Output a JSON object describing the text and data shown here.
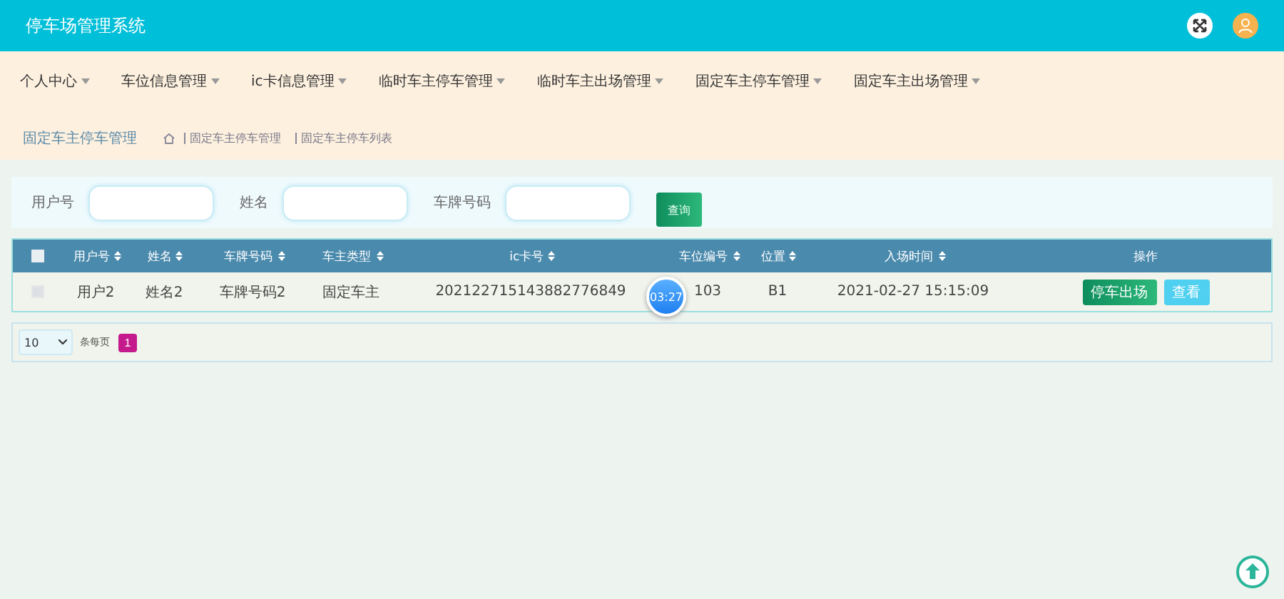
{
  "header": {
    "title": "停车场管理系统"
  },
  "menu": [
    {
      "label": "个人中心"
    },
    {
      "label": "车位信息管理"
    },
    {
      "label": "ic卡信息管理"
    },
    {
      "label": "临时车主停车管理"
    },
    {
      "label": "临时车主出场管理"
    },
    {
      "label": "固定车主停车管理"
    },
    {
      "label": "固定车主出场管理"
    }
  ],
  "breadcrumb": {
    "title": "固定车主停车管理",
    "path": [
      "固定车主停车管理",
      "固定车主停车列表"
    ]
  },
  "search": {
    "fields": [
      {
        "label": "用户号"
      },
      {
        "label": "姓名"
      },
      {
        "label": "车牌号码"
      }
    ],
    "button": "查询"
  },
  "table": {
    "select_all": false,
    "columns": [
      "用户号",
      "姓名",
      "车牌号码",
      "车主类型",
      "ic卡号",
      "车位编号",
      "位置",
      "入场时间",
      "操作"
    ],
    "rows": [
      {
        "checked": false,
        "cells": [
          "用户2",
          "姓名2",
          "车牌号码2",
          "固定车主",
          "202122715143882776849",
          "103",
          "B1",
          "2021-02-27 15:15:09"
        ],
        "actions": [
          {
            "label": "停车出场",
            "kind": "primary"
          },
          {
            "label": "查看",
            "kind": "info"
          }
        ]
      }
    ]
  },
  "pagination": {
    "page_size": "10",
    "page_size_label": "条每页",
    "pages": [
      {
        "label": "1",
        "selected": true
      }
    ]
  },
  "timer": "03:27"
}
